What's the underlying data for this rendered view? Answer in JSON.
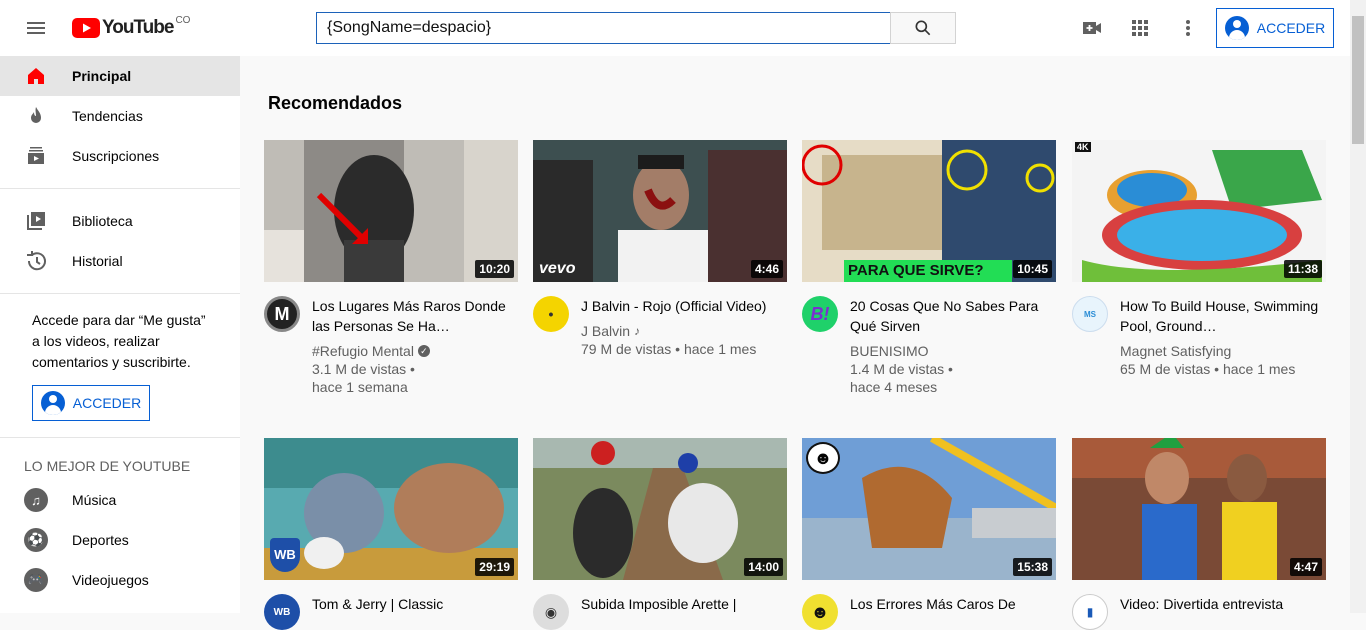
{
  "header": {
    "logo_text": "YouTube",
    "region": "CO",
    "search_value": "{SongName=despacio}",
    "acceder_label": "ACCEDER"
  },
  "sidebar": {
    "items": [
      {
        "label": "Principal",
        "icon": "home-icon"
      },
      {
        "label": "Tendencias",
        "icon": "flame-icon"
      },
      {
        "label": "Suscripciones",
        "icon": "subscriptions-icon"
      },
      {
        "label": "Biblioteca",
        "icon": "library-icon"
      },
      {
        "label": "Historial",
        "icon": "history-icon"
      }
    ],
    "promo_text": "Accede para dar “Me gusta” a los videos, realizar comentarios y suscribirte.",
    "acceder_label": "ACCEDER",
    "best_header": "LO MEJOR DE YOUTUBE",
    "best_items": [
      {
        "label": "Música",
        "icon": "music-icon"
      },
      {
        "label": "Deportes",
        "icon": "sports-icon"
      },
      {
        "label": "Videojuegos",
        "icon": "gaming-icon"
      }
    ]
  },
  "main": {
    "section_title": "Recomendados",
    "videos": [
      {
        "title": "Los Lugares Más Raros Donde las Personas Se Ha…",
        "channel": "#Refugio Mental",
        "views": "3.1 M de vistas •",
        "age": "hace 1 semana",
        "duration": "10:20",
        "verified": true
      },
      {
        "title": "J Balvin - Rojo (Official Video)",
        "channel": "J Balvin",
        "views": "79 M de vistas • hace 1 mes",
        "age": "",
        "duration": "4:46",
        "music": true
      },
      {
        "title": "20 Cosas Que No Sabes Para Qué Sirven",
        "channel": "BUENISIMO",
        "views": "1.4 M de vistas •",
        "age": "hace 4 meses",
        "duration": "10:45"
      },
      {
        "title": "How To Build House, Swimming Pool, Ground…",
        "channel": "Magnet Satisfying",
        "views": "65 M de vistas • hace 1 mes",
        "age": "",
        "duration": "11:38"
      },
      {
        "title": "Tom & Jerry | Classic",
        "duration": "29:19"
      },
      {
        "title": "Subida Imposible Arette |",
        "duration": "14:00"
      },
      {
        "title": "Los Errores Más Caros De",
        "duration": "15:38"
      },
      {
        "title": "Video: Divertida entrevista",
        "duration": "4:47"
      }
    ],
    "thumb_texts": {
      "vevo": "vevo",
      "para_que": "PARA QUE SIRVE?",
      "k4": "4K"
    }
  }
}
